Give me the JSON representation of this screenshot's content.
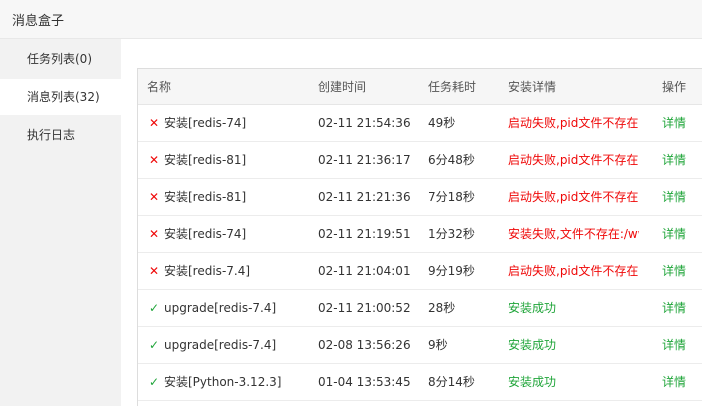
{
  "window": {
    "title": "消息盒子"
  },
  "sidebar": {
    "items": [
      {
        "label": "任务列表(0)"
      },
      {
        "label": "消息列表(32)"
      },
      {
        "label": "执行日志"
      }
    ]
  },
  "table": {
    "headers": {
      "name": "名称",
      "time": "创建时间",
      "cost": "任务耗时",
      "detail": "安装详情",
      "op": "操作"
    },
    "rows": [
      {
        "status": "fail",
        "icon": "✕",
        "name": "安装[redis-74]",
        "time": "02-11 21:54:36",
        "cost": "49秒",
        "detail": "启动失败,pid文件不存在",
        "op": "详情"
      },
      {
        "status": "fail",
        "icon": "✕",
        "name": "安装[redis-81]",
        "time": "02-11 21:36:17",
        "cost": "6分48秒",
        "detail": "启动失败,pid文件不存在",
        "op": "详情"
      },
      {
        "status": "fail",
        "icon": "✕",
        "name": "安装[redis-81]",
        "time": "02-11 21:21:36",
        "cost": "7分18秒",
        "detail": "启动失败,pid文件不存在",
        "op": "详情"
      },
      {
        "status": "fail",
        "icon": "✕",
        "name": "安装[redis-74]",
        "time": "02-11 21:19:51",
        "cost": "1分32秒",
        "detail": "安装失败,文件不存在:/ww",
        "op": "详情"
      },
      {
        "status": "fail",
        "icon": "✕",
        "name": "安装[redis-7.4]",
        "time": "02-11 21:04:01",
        "cost": "9分19秒",
        "detail": "启动失败,pid文件不存在",
        "op": "详情"
      },
      {
        "status": "ok",
        "icon": "✓",
        "name": "upgrade[redis-7.4]",
        "time": "02-11 21:00:52",
        "cost": "28秒",
        "detail": "安装成功",
        "op": "详情"
      },
      {
        "status": "ok",
        "icon": "✓",
        "name": "upgrade[redis-7.4]",
        "time": "02-08 13:56:26",
        "cost": "9秒",
        "detail": "安装成功",
        "op": "详情"
      },
      {
        "status": "ok",
        "icon": "✓",
        "name": "安装[Python-3.12.3]",
        "time": "01-04 13:53:45",
        "cost": "8分14秒",
        "detail": "安装成功",
        "op": "详情"
      }
    ]
  }
}
